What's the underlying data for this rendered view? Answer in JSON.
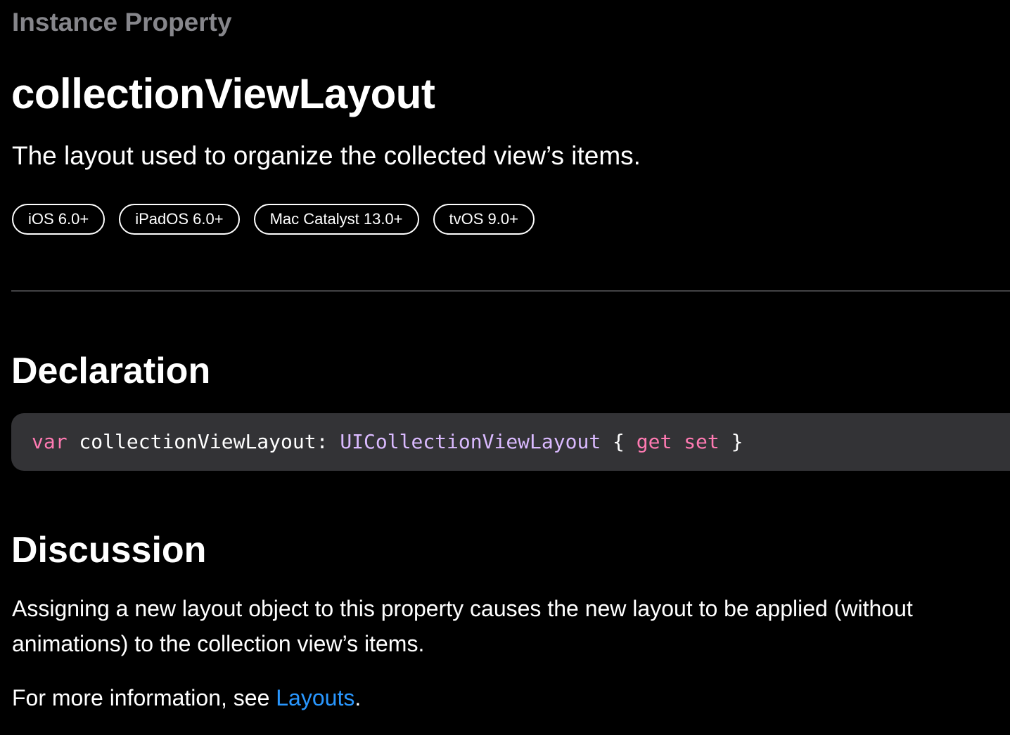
{
  "eyebrow": "Instance Property",
  "title": "collectionViewLayout",
  "abstract": "The layout used to organize the collected view’s items.",
  "availability": [
    {
      "label": "iOS 6.0+"
    },
    {
      "label": "iPadOS 6.0+"
    },
    {
      "label": "Mac Catalyst 13.0+"
    },
    {
      "label": "tvOS 9.0+"
    }
  ],
  "declaration": {
    "heading": "Declaration",
    "code": {
      "keyword_var": "var",
      "name": " collectionViewLayout: ",
      "type": "UICollectionViewLayout",
      "brace_open": " { ",
      "keyword_get": "get",
      "space": " ",
      "keyword_set": "set",
      "brace_close": " }"
    }
  },
  "discussion": {
    "heading": "Discussion",
    "paragraph_1": "Assigning a new layout object to this property causes the new layout to be applied (without animations) to the collection view’s items.",
    "paragraph_2_prefix": "For more information, see ",
    "paragraph_2_link": "Layouts",
    "paragraph_2_suffix": "."
  },
  "colors": {
    "background": "#000000",
    "eyebrow": "#86868b",
    "code_background": "#333336",
    "keyword": "#ff7ab2",
    "type": "#dabaff",
    "link": "#2997ff",
    "divider": "#424245"
  }
}
